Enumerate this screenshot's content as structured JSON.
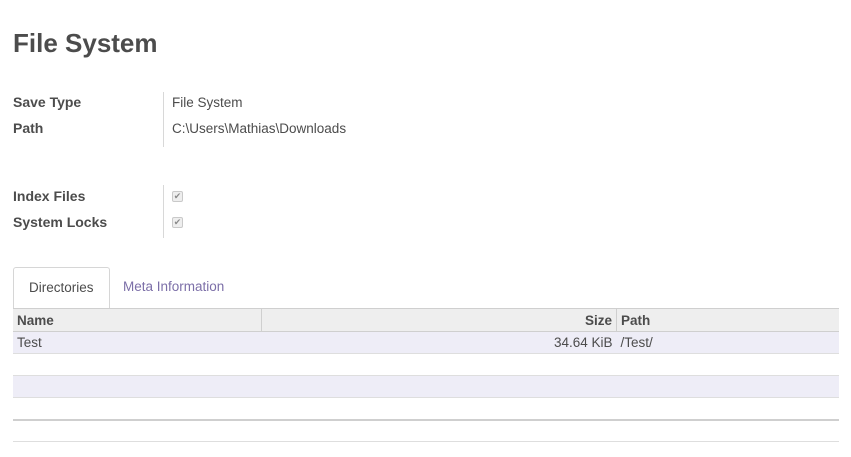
{
  "page": {
    "title": "File System"
  },
  "fields_top": [
    {
      "label": "Save Type",
      "value": "File System"
    },
    {
      "label": "Path",
      "value": "C:\\Users\\Mathias\\Downloads"
    }
  ],
  "fields_flags": [
    {
      "label": "Index Files",
      "checked": true
    },
    {
      "label": "System Locks",
      "checked": true
    }
  ],
  "tabs": [
    {
      "label": "Directories",
      "active": true
    },
    {
      "label": "Meta Information",
      "active": false
    }
  ],
  "table": {
    "columns": {
      "name": "Name",
      "size": "Size",
      "path": "Path"
    },
    "rows": [
      {
        "name": "Test",
        "size": "34.64 KiB",
        "path": "/Test/"
      }
    ]
  },
  "colors": {
    "link": "#7c6fa8",
    "row_alt": "#eeedf7",
    "header_bg": "#eeeeee"
  },
  "icons": {
    "checkbox_mark": "check-icon"
  }
}
